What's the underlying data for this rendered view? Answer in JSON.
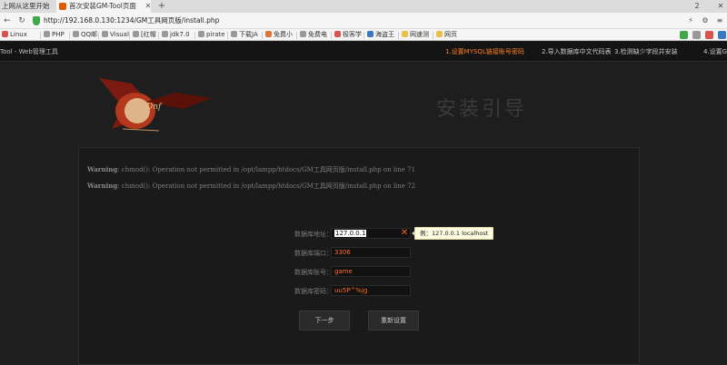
{
  "browser": {
    "tabs": [
      {
        "label": "上网从这里开始",
        "active": false
      },
      {
        "label": "首次安装GM-Tool页面",
        "active": true
      }
    ],
    "new_tab": "+",
    "window": {
      "badge": "2",
      "close": "✕",
      "minimize": "—",
      "restore": "☐"
    },
    "url": "http://192.168.0.130:1234/GM工具网页版/install.php",
    "nav": {
      "back": "←",
      "forward": "→",
      "reload": "↻"
    },
    "bookmarks": [
      {
        "label": "Linux",
        "color": "#d9534f"
      },
      {
        "label": "PHP",
        "color": "#999999"
      },
      {
        "label": "QQ邮",
        "color": "#999999"
      },
      {
        "label": "Visual",
        "color": "#999999"
      },
      {
        "label": "[红帽",
        "color": "#999999"
      },
      {
        "label": "jdk7.0",
        "color": "#999999"
      },
      {
        "label": "pirate",
        "color": "#999999"
      },
      {
        "label": "下载JA",
        "color": "#999999"
      },
      {
        "label": "免费小",
        "color": "#e0743a"
      },
      {
        "label": "免费电",
        "color": "#999999"
      },
      {
        "label": "极客学",
        "color": "#d9534f"
      },
      {
        "label": "海盗王",
        "color": "#3a78c2"
      },
      {
        "label": "网速测",
        "color": "#e8c04a"
      },
      {
        "label": "网页",
        "color": "#e8c04a"
      }
    ]
  },
  "page": {
    "app_title": "Tool - Web管理工具",
    "steps": [
      {
        "label": "1.设置MYSQL链接账号密码",
        "current": true
      },
      {
        "label": "2.导入数据库中文代码表",
        "current": false
      },
      {
        "label": "3.检测缺少字段并安装",
        "current": false
      },
      {
        "label": "4.设置G",
        "current": false
      }
    ],
    "header_title": "安装引导",
    "logo_text": "Dnf",
    "warnings": [
      {
        "label": "Warning",
        "text": ": chmod(): Operation not permitted in /opt/lampp/htdocs/GM工具网页版/install.php on line 71"
      },
      {
        "label": "Warning",
        "text": ": chmod(): Operation not permitted in /opt/lampp/htdocs/GM工具网页版/install.php on line 72"
      }
    ],
    "form": {
      "db_host_label": "数据库地址：",
      "db_host_value": "127.0.0.1",
      "db_host_hint": "例：127.0.0.1 localhost",
      "db_port_label": "数据库端口：",
      "db_port_value": "3306",
      "db_user_label": "数据库账号：",
      "db_user_value": "game",
      "db_pass_label": "数据库密码：",
      "db_pass_value": "uu5P^%jg"
    },
    "buttons": {
      "next": "下一步",
      "reset": "重新设置"
    },
    "colors": {
      "accent": "#ff7f24",
      "background": "#1e1e1e",
      "field_text": "#ff6a2a"
    }
  }
}
